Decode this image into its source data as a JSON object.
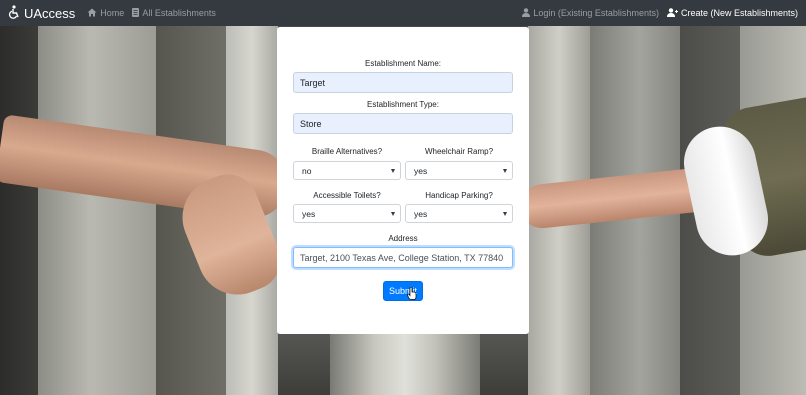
{
  "navbar": {
    "brand": "UAccess",
    "links": {
      "home": "Home",
      "all_establishments": "All Establishments",
      "login": "Login (Existing Establishments)",
      "create": "Create (New Establishments)"
    },
    "icons": [
      "wheelchair-icon",
      "home-icon",
      "list-icon",
      "user-icon",
      "user-plus-icon"
    ],
    "colors": {
      "background": "#343a40",
      "link": "#9a9da1",
      "active_link": "#ffffff"
    }
  },
  "form": {
    "establishment_name": {
      "label": "Establishment Name:",
      "value": "Target"
    },
    "establishment_type": {
      "label": "Establishment Type:",
      "value": "Store"
    },
    "braille": {
      "label": "Braille Alternatives?",
      "value": "no"
    },
    "wheelchair_ramp": {
      "label": "Wheelchair Ramp?",
      "value": "yes"
    },
    "accessible_toilets": {
      "label": "Accessible Toilets?",
      "value": "yes"
    },
    "handicap_parking": {
      "label": "Handicap Parking?",
      "value": "yes"
    },
    "address": {
      "label": "Address",
      "value": "Target, 2100 Texas Ave, College Station, TX 77840"
    },
    "submit_label": "Submit",
    "colors": {
      "autofill_bg": "#e8f0fe",
      "submit_bg": "#007bff",
      "focus_border": "#80bdff"
    }
  }
}
